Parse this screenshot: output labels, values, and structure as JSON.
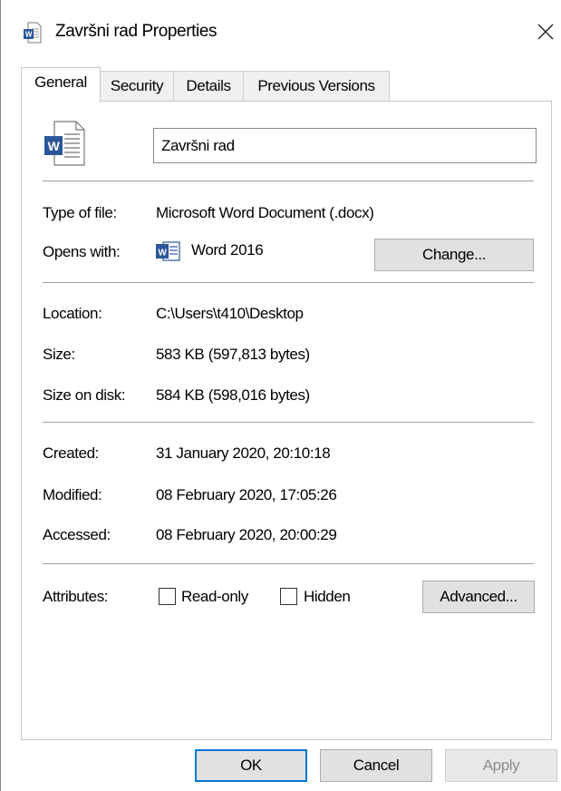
{
  "window": {
    "title": "Završni rad Properties",
    "close_symbol": "✕"
  },
  "tabs": [
    {
      "label": "General"
    },
    {
      "label": "Security"
    },
    {
      "label": "Details"
    },
    {
      "label": "Previous Versions"
    }
  ],
  "file": {
    "name": "Završni rad"
  },
  "type": {
    "label": "Type of file:",
    "value": "Microsoft Word Document (.docx)"
  },
  "opens_with": {
    "label": "Opens with:",
    "value": "Word 2016",
    "change_button": "Change..."
  },
  "location": {
    "label": "Location:",
    "value": "C:\\Users\\t410\\Desktop"
  },
  "size": {
    "label": "Size:",
    "value": "583 KB (597,813 bytes)"
  },
  "size_on_disk": {
    "label": "Size on disk:",
    "value": "584 KB (598,016 bytes)"
  },
  "created": {
    "label": "Created:",
    "value": "31 January 2020, 20:10:18"
  },
  "modified": {
    "label": "Modified:",
    "value": "08 February 2020, 17:05:26"
  },
  "accessed": {
    "label": "Accessed:",
    "value": "08 February 2020, 20:00:29"
  },
  "attributes": {
    "label": "Attributes:",
    "read_only": {
      "label": "Read-only",
      "checked": false
    },
    "hidden": {
      "label": "Hidden",
      "checked": false
    },
    "advanced_button": "Advanced..."
  },
  "buttons": {
    "ok": "OK",
    "cancel": "Cancel",
    "apply": "Apply"
  },
  "colors": {
    "word_blue": "#2b579a",
    "focus_blue": "#0078d7"
  }
}
